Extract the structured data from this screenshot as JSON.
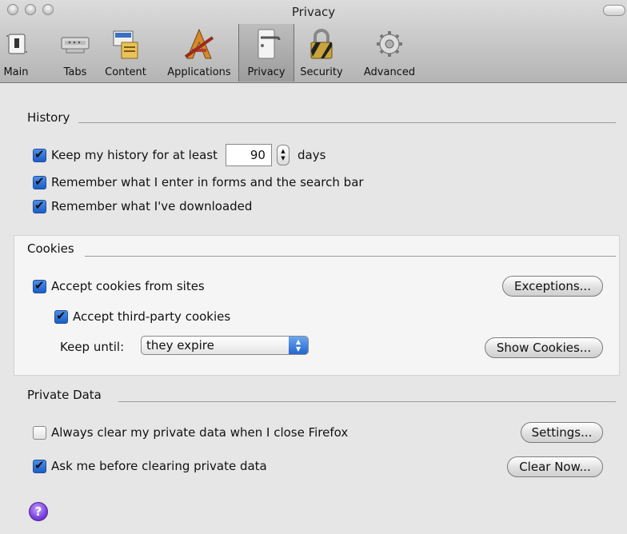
{
  "window": {
    "title": "Privacy"
  },
  "toolbar": {
    "items": [
      {
        "label": "Main",
        "icon": "switch-icon"
      },
      {
        "label": "Tabs",
        "icon": "tabs-icon"
      },
      {
        "label": "Content",
        "icon": "content-icon"
      },
      {
        "label": "Applications",
        "icon": "applications-icon"
      },
      {
        "label": "Privacy",
        "icon": "privacy-icon",
        "selected": true
      },
      {
        "label": "Security",
        "icon": "lock-icon"
      },
      {
        "label": "Advanced",
        "icon": "gear-icon"
      }
    ]
  },
  "history": {
    "title": "History",
    "keep_label": "Keep my history for at least",
    "days_value": "90",
    "days_label": "days",
    "forms_label": "Remember what I enter in forms and the search bar",
    "downloads_label": "Remember what I've downloaded"
  },
  "cookies": {
    "title": "Cookies",
    "accept_label": "Accept cookies from sites",
    "third_party_label": "Accept third-party cookies",
    "keep_until_label": "Keep until:",
    "keep_until_value": "they expire",
    "exceptions_button": "Exceptions...",
    "show_cookies_button": "Show Cookies..."
  },
  "private_data": {
    "title": "Private Data",
    "always_clear_label": "Always clear my private data when I close Firefox",
    "ask_label": "Ask me before clearing private data",
    "settings_button": "Settings...",
    "clear_now_button": "Clear Now..."
  },
  "help": {
    "label": "?"
  },
  "colors": {
    "checkbox_blue": "#2a6ed6",
    "panel_bg": "#e6e6e6",
    "cookie_box_bg": "#f5f5f5"
  }
}
